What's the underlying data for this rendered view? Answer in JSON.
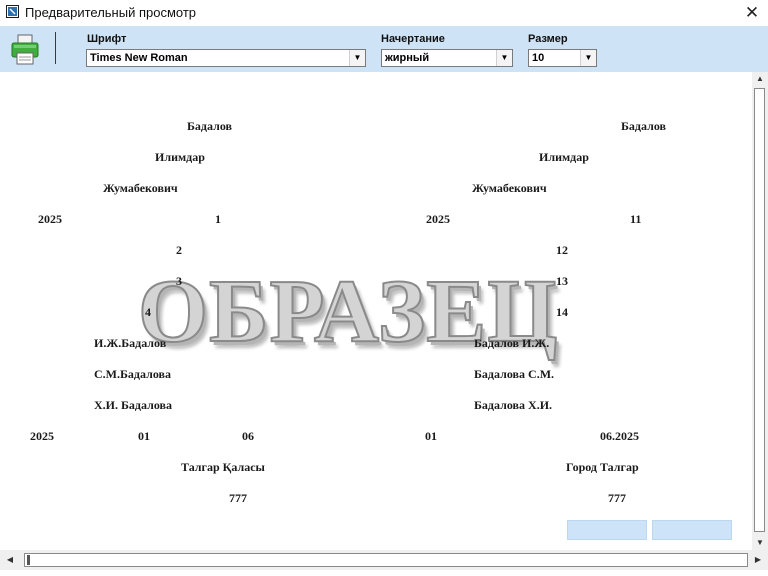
{
  "window": {
    "title": "Предварительный просмотр"
  },
  "toolbar": {
    "font_label": "Шрифт",
    "font_value": "Times New Roman",
    "style_label": "Начертание",
    "style_value": "жирный",
    "size_label": "Размер",
    "size_value": "10"
  },
  "preview": {
    "watermark": "ОБРАЗЕЦ",
    "left": {
      "surname": "Бадалов",
      "name": "Илимдар",
      "patronymic": "Жумабекович",
      "year": "2025",
      "n1": "1",
      "n2": "2",
      "n3": "3",
      "n4": "4",
      "sig1": "И.Ж.Бадалов",
      "sig2": "С.М.Бадалова",
      "sig3": "Х.И. Бадалова",
      "date_year": "2025",
      "date_day": "01",
      "date_month": "06",
      "city": "Талгар Қаласы",
      "code": "777"
    },
    "right": {
      "surname": "Бадалов",
      "name": "Илимдар",
      "patronymic": "Жумабекович",
      "year": "2025",
      "n1": "11",
      "n2": "12",
      "n3": "13",
      "n4": "14",
      "sig1": "Бадалов И.Ж.",
      "sig2": "Бадалова С.М.",
      "sig3": "Бадалова Х.И.",
      "date_day": "01",
      "date_monthyear": "06.2025",
      "city": "Город Талгар",
      "code": "777"
    }
  },
  "colors": {
    "toolbar_bg": "#cfe3f6",
    "printer_green": "#3fae3f"
  },
  "icons": {
    "app": "app-icon",
    "close": "close-icon",
    "print": "printer-icon"
  }
}
